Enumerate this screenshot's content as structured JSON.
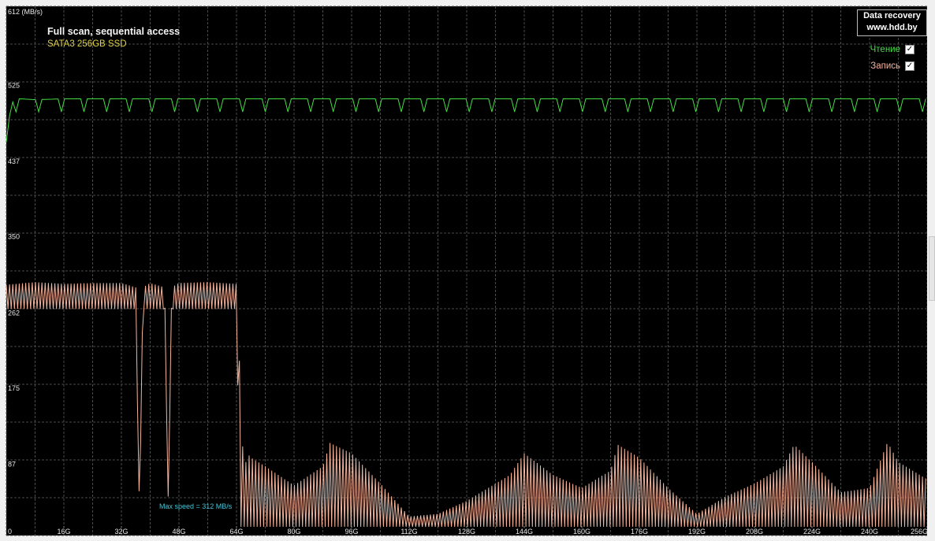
{
  "chart_data": {
    "type": "line",
    "title": "Full scan, sequential access",
    "subtitle": "SATA3 256GB SSD",
    "ylabel_unit": "612 (MB/s)",
    "ylim": [
      0,
      612
    ],
    "y_ticks": [
      "525",
      "437",
      "350",
      "262",
      "175",
      "87",
      "0"
    ],
    "xlim": [
      0,
      256
    ],
    "x_ticks": [
      "16G",
      "32G",
      "48G",
      "64G",
      "80G",
      "96G",
      "112G",
      "128G",
      "144G",
      "160G",
      "176G",
      "192G",
      "208G",
      "224G",
      "240G",
      "256G"
    ],
    "grid": true,
    "legend_position": "top-right",
    "series": [
      {
        "name": "Чтение",
        "color": "#44dd44",
        "x": [
          0,
          0.5,
          2,
          4,
          8,
          16,
          32,
          48,
          64,
          80,
          96,
          112,
          128,
          144,
          160,
          176,
          192,
          208,
          224,
          240,
          256
        ],
        "values": [
          455,
          478,
          505,
          505,
          504,
          505,
          505,
          505,
          505,
          505,
          505,
          505,
          505,
          505,
          505,
          505,
          505,
          505,
          505,
          505,
          505
        ],
        "min_values": [
          455,
          478,
          490,
          490,
          490,
          490,
          490,
          490,
          490,
          490,
          490,
          490,
          490,
          490,
          490,
          490,
          490,
          490,
          490,
          490,
          490
        ]
      },
      {
        "name": "Запись",
        "color": "#f4b49c",
        "x": [
          0,
          8,
          16,
          24,
          32,
          36,
          37,
          38,
          40,
          44,
          45,
          46,
          48,
          56,
          64,
          65,
          66,
          67,
          68,
          72,
          80,
          88,
          90,
          96,
          104,
          112,
          120,
          128,
          136,
          140,
          144,
          152,
          160,
          168,
          170,
          176,
          184,
          192,
          200,
          208,
          216,
          219,
          224,
          232,
          240,
          245,
          248,
          256
        ],
        "values": [
          290,
          293,
          291,
          292,
          292,
          287,
          25,
          287,
          292,
          287,
          45,
          287,
          292,
          293,
          291,
          180,
          70,
          95,
          90,
          80,
          58,
          80,
          107,
          95,
          60,
          22,
          25,
          40,
          60,
          70,
          95,
          70,
          55,
          75,
          105,
          90,
          55,
          25,
          45,
          60,
          80,
          105,
          85,
          50,
          55,
          108,
          85,
          65
        ],
        "min_values": [
          262,
          262,
          262,
          262,
          262,
          262,
          25,
          262,
          262,
          262,
          45,
          262,
          262,
          262,
          262,
          10,
          10,
          10,
          10,
          10,
          10,
          10,
          10,
          10,
          10,
          10,
          10,
          10,
          10,
          10,
          10,
          10,
          10,
          10,
          10,
          10,
          10,
          10,
          10,
          10,
          10,
          10,
          10,
          10,
          10,
          10,
          10,
          10
        ]
      }
    ]
  },
  "legend": {
    "read_label": "Чтение",
    "write_label": "Запись",
    "read_checked": "✓",
    "write_checked": "✓"
  },
  "brand": {
    "line1": "Data recovery",
    "line2": "www.hdd.by"
  },
  "annotation": {
    "max_speed": "Max speed = 312 MB/s"
  },
  "colors": {
    "background": "#000000",
    "grid": "#4a4a4a",
    "frame": "#f0f0f0"
  }
}
